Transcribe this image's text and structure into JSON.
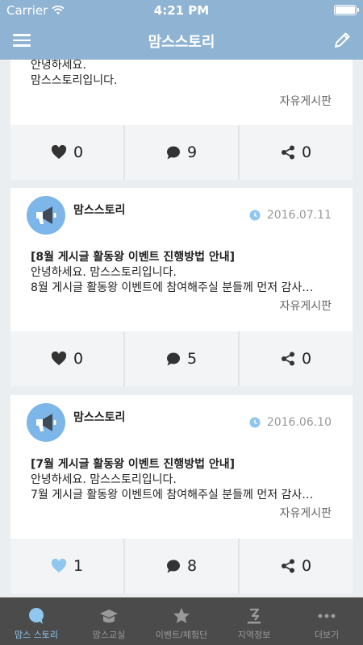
{
  "status_bar": {
    "carrier": "Carrier",
    "time": "4:21 PM"
  },
  "navbar": {
    "title": "맘스스토리",
    "menu_icon": "hamburger-icon",
    "edit_icon": "pencil-icon"
  },
  "posts": [
    {
      "author": "",
      "date": "",
      "lines": [
        "안녕하세요.",
        "맘스스토리입니다."
      ],
      "board": "자유게시판",
      "likes": "0",
      "comments": "9",
      "shares": "0",
      "liked": false
    },
    {
      "author": "맘스스토리",
      "date": "2016.07.11",
      "subject": "[8월 게시글 활동왕 이벤트 진행방법 안내]",
      "lines": [
        "안녕하세요. 맘스스토리입니다.",
        "8월 게시글 활동왕 이벤트에 참여해주실 분들께 먼저 감사…"
      ],
      "board": "자유게시판",
      "likes": "0",
      "comments": "5",
      "shares": "0",
      "liked": false
    },
    {
      "author": "맘스스토리",
      "date": "2016.06.10",
      "subject": "[7월 게시글 활동왕 이벤트 진행방법 안내]",
      "lines": [
        "안녕하세요. 맘스스토리입니다.",
        "7월 게시글 활동왕 이벤트에 참여해주실 분들께 먼저 감사…"
      ],
      "board": "자유게시판",
      "likes": "1",
      "comments": "8",
      "shares": "0",
      "liked": true
    }
  ],
  "tabs": [
    {
      "label": "맘스 스토리",
      "icon": "chat-bubble-icon",
      "active": true
    },
    {
      "label": "맘스교실",
      "icon": "graduation-cap-icon",
      "active": false
    },
    {
      "label": "이벤트/체험단",
      "icon": "star-icon",
      "active": false
    },
    {
      "label": "지역정보",
      "icon": "map-pin-icon",
      "active": false
    },
    {
      "label": "더보기",
      "icon": "more-dots-icon",
      "active": false
    }
  ],
  "colors": {
    "header": "#8fb3d3",
    "accent": "#8fc7f0",
    "tabbar": "#4b4b4b",
    "liked_heart": "#8fc7f0"
  }
}
